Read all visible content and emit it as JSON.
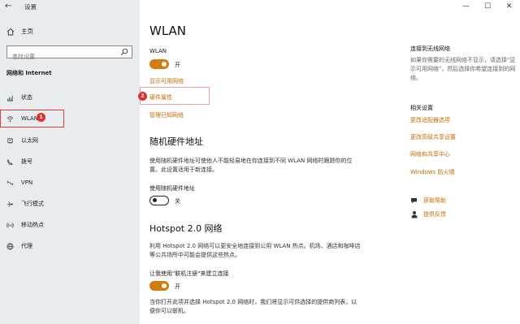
{
  "app": {
    "title": "设置"
  },
  "sidebar": {
    "home_label": "主页",
    "search_placeholder": "查找设置",
    "section_label": "网络和 Internet",
    "items": [
      {
        "label": "状态",
        "icon": "status-icon"
      },
      {
        "label": "WLAN",
        "icon": "wifi-icon"
      },
      {
        "label": "以太网",
        "icon": "ethernet-icon"
      },
      {
        "label": "拨号",
        "icon": "dialup-icon"
      },
      {
        "label": "VPN",
        "icon": "vpn-icon"
      },
      {
        "label": "飞行模式",
        "icon": "airplane-icon"
      },
      {
        "label": "移动热点",
        "icon": "hotspot-icon"
      },
      {
        "label": "代理",
        "icon": "globe-icon"
      }
    ],
    "badge_1": "1"
  },
  "main": {
    "title": "WLAN",
    "wlan_label": "WLAN",
    "wlan_toggle_state": "开",
    "link_show_networks": "显示可用网络",
    "link_hardware": "硬件属性",
    "link_manage": "管理已知网络",
    "badge_2": "2",
    "random_heading": "随机硬件地址",
    "random_desc": "使用随机硬件地址可使他人不能轻易地在你连接到不同 WLAN 网络时跟踪你的位置。此设置适用于新连接。",
    "random_toggle_label": "使用随机硬件地址",
    "random_toggle_state": "关",
    "hotspot_heading": "Hotspot 2.0 网络",
    "hotspot_desc": "利用 Hotspot 2.0 网络可以更安全地连接到公用 WLAN 热点。机场、酒店和咖啡店等公共场所中可能会提供这些热点。",
    "hotspot_toggle_label": "让我使用\"联机注册\"来建立连接",
    "hotspot_toggle_state": "开",
    "hotspot_footer": "当你打开此项并选择 Hotspot 2.0 网络时，我们将显示可供选择的提供商列表，以便你可以联机。"
  },
  "right": {
    "connect_title": "连接到无线网络",
    "connect_desc": "如果你需要的无线网络不显示，请选择\"显示可用网络\"，然后选择你希望连接到的网络。",
    "related_title": "相关设置",
    "related_links": [
      "更改适配器选项",
      "更改高级共享设置",
      "网络和共享中心",
      "Windows 防火墙"
    ],
    "help_label": "获取帮助",
    "feedback_label": "提供反馈"
  },
  "colors": {
    "accent": "#c56a00",
    "toggle_on": "#d27c0a",
    "annotation_red": "#e23030"
  }
}
